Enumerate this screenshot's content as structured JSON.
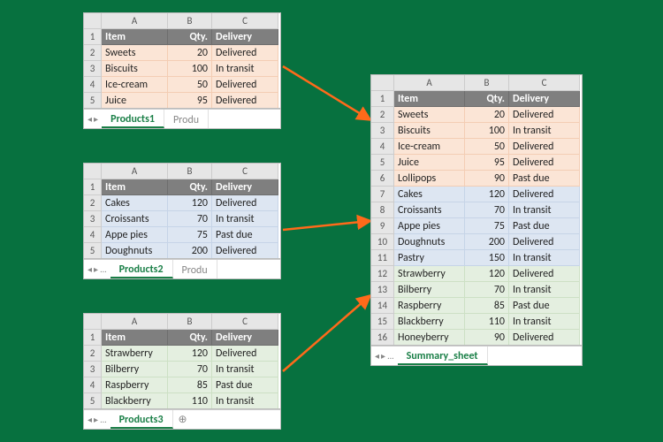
{
  "columns": [
    "A",
    "B",
    "C"
  ],
  "headers": {
    "item": "Item",
    "qty": "Qty.",
    "delivery": "Delivery"
  },
  "panels": {
    "p1": {
      "tab_active": "Products1",
      "tab_next": "Produ",
      "rows": [
        {
          "n": "2",
          "item": "Sweets",
          "qty": "20",
          "delivery": "Delivered"
        },
        {
          "n": "3",
          "item": "Biscuits",
          "qty": "100",
          "delivery": "In transit"
        },
        {
          "n": "4",
          "item": "Ice-cream",
          "qty": "50",
          "delivery": "Delivered"
        },
        {
          "n": "5",
          "item": "Juice",
          "qty": "95",
          "delivery": "Delivered"
        }
      ]
    },
    "p2": {
      "tab_active": "Products2",
      "tab_next": "Produ",
      "rows": [
        {
          "n": "2",
          "item": "Cakes",
          "qty": "120",
          "delivery": "Delivered"
        },
        {
          "n": "3",
          "item": "Croissants",
          "qty": "70",
          "delivery": "In transit"
        },
        {
          "n": "4",
          "item": "Appe pies",
          "qty": "75",
          "delivery": "Past due"
        },
        {
          "n": "5",
          "item": "Doughnuts",
          "qty": "200",
          "delivery": "Delivered"
        }
      ]
    },
    "p3": {
      "tab_active": "Products3",
      "rows": [
        {
          "n": "2",
          "item": "Strawberry",
          "qty": "120",
          "delivery": "Delivered"
        },
        {
          "n": "3",
          "item": "Bilberry",
          "qty": "70",
          "delivery": "In transit"
        },
        {
          "n": "4",
          "item": "Raspberry",
          "qty": "85",
          "delivery": "Past due"
        },
        {
          "n": "5",
          "item": "Blackberry",
          "qty": "110",
          "delivery": "In transit"
        }
      ]
    },
    "summary": {
      "tab_active": "Summary_sheet",
      "rows": [
        {
          "n": "2",
          "tint": "o",
          "item": "Sweets",
          "qty": "20",
          "delivery": "Delivered"
        },
        {
          "n": "3",
          "tint": "o",
          "item": "Biscuits",
          "qty": "100",
          "delivery": "In transit"
        },
        {
          "n": "4",
          "tint": "o",
          "item": "Ice-cream",
          "qty": "50",
          "delivery": "Delivered"
        },
        {
          "n": "5",
          "tint": "o",
          "item": "Juice",
          "qty": "95",
          "delivery": "Delivered"
        },
        {
          "n": "6",
          "tint": "o",
          "item": "Lollipops",
          "qty": "90",
          "delivery": "Past due"
        },
        {
          "n": "7",
          "tint": "b",
          "item": "Cakes",
          "qty": "120",
          "delivery": "Delivered"
        },
        {
          "n": "8",
          "tint": "b",
          "item": "Croissants",
          "qty": "70",
          "delivery": "In transit"
        },
        {
          "n": "9",
          "tint": "b",
          "item": "Appe pies",
          "qty": "75",
          "delivery": "Past due"
        },
        {
          "n": "10",
          "tint": "b",
          "item": "Doughnuts",
          "qty": "200",
          "delivery": "Delivered"
        },
        {
          "n": "11",
          "tint": "b",
          "item": "Pastry",
          "qty": "150",
          "delivery": "In transit"
        },
        {
          "n": "12",
          "tint": "g",
          "item": "Strawberry",
          "qty": "120",
          "delivery": "Delivered"
        },
        {
          "n": "13",
          "tint": "g",
          "item": "Bilberry",
          "qty": "70",
          "delivery": "In transit"
        },
        {
          "n": "14",
          "tint": "g",
          "item": "Raspberry",
          "qty": "85",
          "delivery": "Past due"
        },
        {
          "n": "15",
          "tint": "g",
          "item": "Blackberry",
          "qty": "110",
          "delivery": "In transit"
        },
        {
          "n": "16",
          "tint": "g",
          "item": "Honeyberry",
          "qty": "90",
          "delivery": "Delivered"
        }
      ]
    }
  },
  "nav": {
    "prev": "◂",
    "next": "▸",
    "more": "..."
  },
  "add": "⊕"
}
